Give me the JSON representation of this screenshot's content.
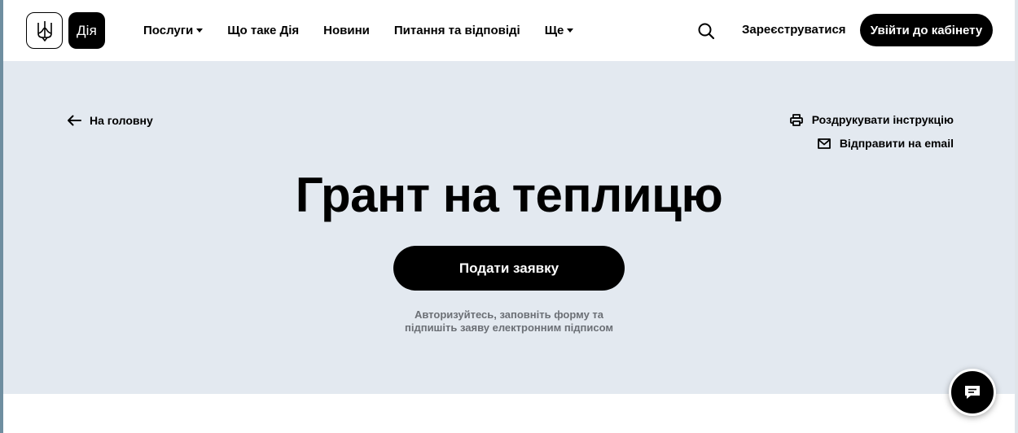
{
  "header": {
    "logo_text": "Дія",
    "nav": [
      {
        "label": "Послуги",
        "has_dropdown": true
      },
      {
        "label": "Що таке Дія",
        "has_dropdown": false
      },
      {
        "label": "Новини",
        "has_dropdown": false
      },
      {
        "label": "Питання та відповіді",
        "has_dropdown": false
      },
      {
        "label": "Ще",
        "has_dropdown": true
      }
    ],
    "register_label": "Зареєструватися",
    "login_label": "Увійти до кабінету"
  },
  "hero": {
    "back_label": "На головну",
    "print_label": "Роздрукувати інструкцію",
    "email_label": "Відправити на email",
    "title": "Грант на теплицю",
    "apply_label": "Подати заявку",
    "hint_line1": "Авторизуйтесь, заповніть форму та",
    "hint_line2": "підпишіть заяву електронним підписом"
  },
  "icons": {
    "logo": "trident-icon",
    "search": "search-icon",
    "back": "arrow-left-icon",
    "print": "printer-icon",
    "email": "envelope-icon",
    "chat": "chat-icon"
  },
  "colors": {
    "hero_background": "#e3e9f0",
    "primary": "#000000",
    "hint_text": "#6b6f75"
  }
}
